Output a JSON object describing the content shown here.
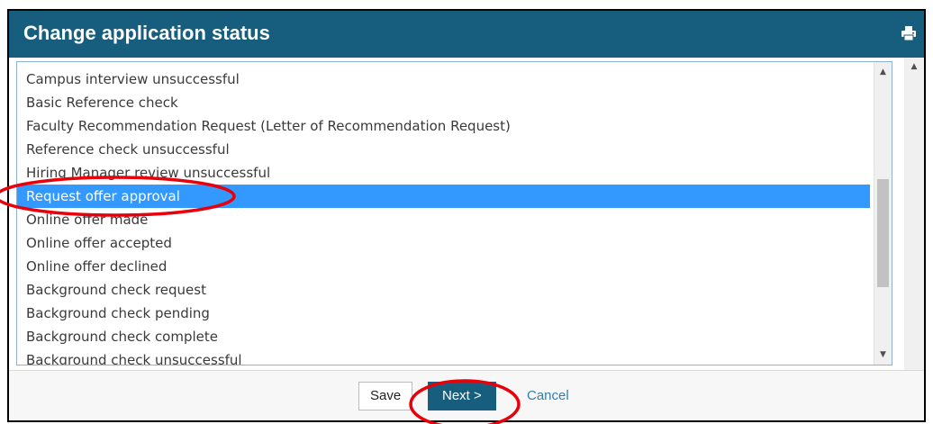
{
  "dialog": {
    "title": "Change application status",
    "print_icon": "printer-icon"
  },
  "status_list": {
    "items": [
      "Campus interview unsuccessful",
      "Basic Reference check",
      "Faculty Recommendation Request (Letter of Recommendation Request)",
      "Reference check unsuccessful",
      "Hiring Manager review unsuccessful",
      "Request offer approval",
      "Online offer made",
      "Online offer accepted",
      "Online offer declined",
      "Background check request",
      "Background check pending",
      "Background check complete",
      "Background check unsuccessful"
    ],
    "selected": "Request offer approval",
    "selection_color": "#3399ff"
  },
  "footer": {
    "save_label": "Save",
    "next_label": "Next >",
    "cancel_label": "Cancel"
  },
  "colors": {
    "header": "#175e7e",
    "annotation_circle": "#e8000b",
    "link": "#2f7fb5"
  }
}
